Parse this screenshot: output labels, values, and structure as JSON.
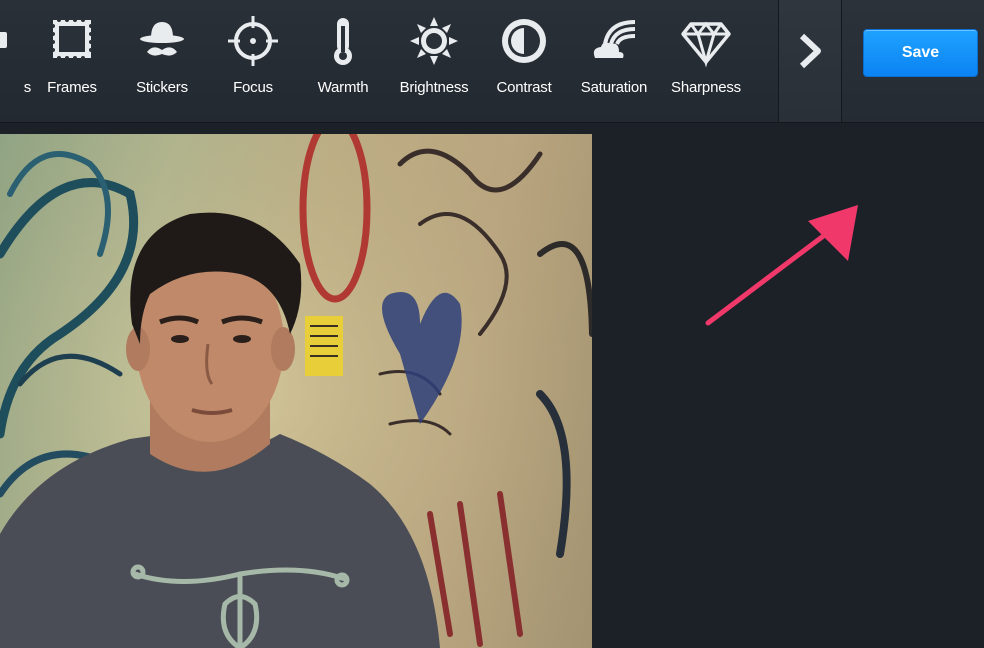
{
  "toolbar": {
    "partial_tool_label": "s",
    "tools": [
      {
        "label": "Frames",
        "icon": "frame-icon"
      },
      {
        "label": "Stickers",
        "icon": "hat-mustache-icon"
      },
      {
        "label": "Focus",
        "icon": "crosshair-icon"
      },
      {
        "label": "Warmth",
        "icon": "thermometer-icon"
      },
      {
        "label": "Brightness",
        "icon": "sun-icon"
      },
      {
        "label": "Contrast",
        "icon": "contrast-icon"
      },
      {
        "label": "Saturation",
        "icon": "rainbow-cloud-icon"
      },
      {
        "label": "Sharpness",
        "icon": "diamond-icon"
      }
    ],
    "next_icon": "chevron-right-icon",
    "save_label": "Save"
  },
  "colors": {
    "save_button": "#1196f8",
    "annotation_arrow": "#f0386b",
    "toolbar_bg": "#262c33",
    "canvas_bg": "#1c2127"
  }
}
